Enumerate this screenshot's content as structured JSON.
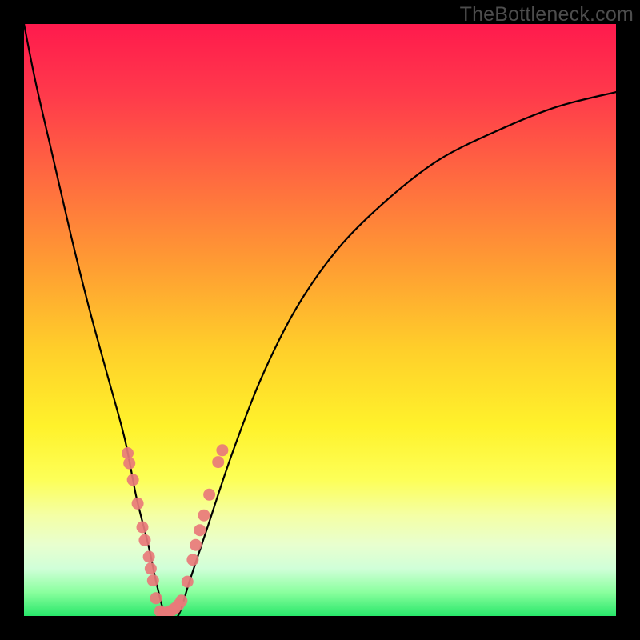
{
  "watermark": "TheBottleneck.com",
  "chart_data": {
    "type": "line",
    "title": "",
    "xlabel": "",
    "ylabel": "",
    "xlim": [
      0,
      100
    ],
    "ylim": [
      0,
      100
    ],
    "grid": false,
    "series": [
      {
        "name": "bottleneck-curve",
        "x": [
          0,
          2,
          5,
          8,
          11,
          14,
          17,
          19,
          21,
          22.5,
          24,
          26,
          28,
          31,
          35,
          40,
          46,
          53,
          61,
          70,
          80,
          90,
          100
        ],
        "y": [
          100,
          90,
          77,
          64,
          52,
          41,
          30,
          20,
          12,
          5,
          0,
          0,
          6,
          15,
          27,
          40,
          52,
          62,
          70,
          77,
          82,
          86,
          88.5
        ],
        "color": "#000000"
      },
      {
        "name": "marker-cluster-left",
        "type": "scatter",
        "x": [
          17.5,
          17.8,
          18.4,
          19.2,
          20.0,
          20.4,
          21.1,
          21.4,
          21.8,
          22.3
        ],
        "y": [
          27.5,
          25.8,
          23.0,
          19.0,
          15.0,
          12.8,
          10.0,
          8.0,
          6.0,
          3.0
        ],
        "color": "#e87a7a"
      },
      {
        "name": "marker-cluster-bottom",
        "type": "scatter",
        "x": [
          23.0,
          23.6,
          24.2,
          24.9,
          25.5,
          26.1,
          26.6
        ],
        "y": [
          0.8,
          0.5,
          0.6,
          0.9,
          1.3,
          1.9,
          2.6
        ],
        "color": "#e87a7a"
      },
      {
        "name": "marker-cluster-right",
        "type": "scatter",
        "x": [
          27.6,
          28.5,
          29.0,
          29.7,
          30.4,
          31.3,
          32.8,
          33.5
        ],
        "y": [
          5.8,
          9.5,
          12.0,
          14.5,
          17.0,
          20.5,
          26.0,
          28.0
        ],
        "color": "#e87a7a"
      }
    ],
    "background_gradient": {
      "top": "#ff1a4d",
      "middle": "#fff22b",
      "bottom": "#28e76a"
    }
  }
}
